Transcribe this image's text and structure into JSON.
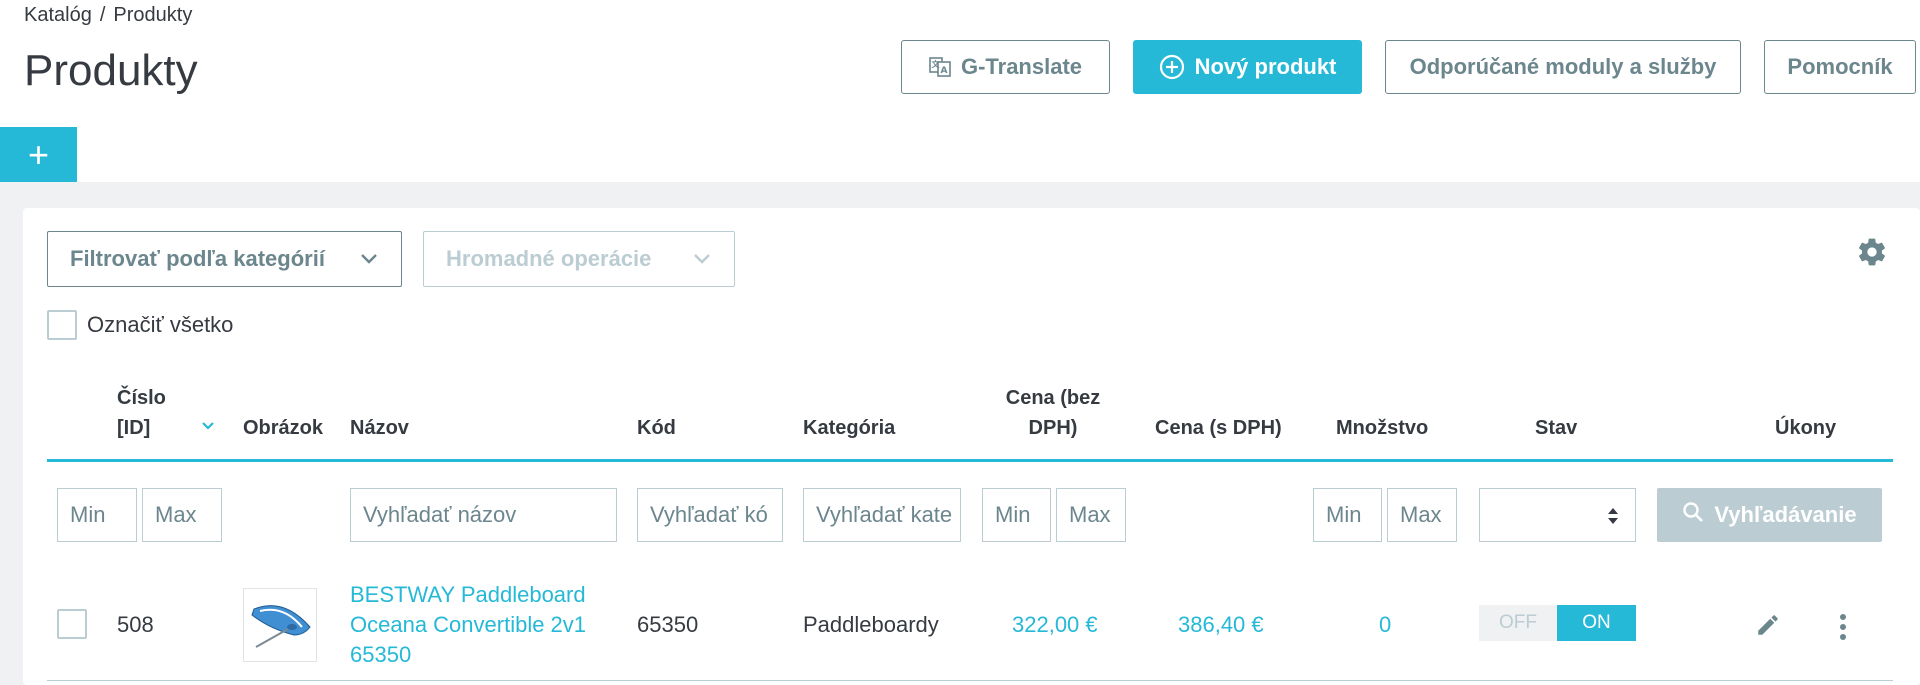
{
  "breadcrumb": {
    "item1": "Katalóg",
    "separator": "/",
    "item2": "Produkty"
  },
  "page_title": "Produkty",
  "header_buttons": {
    "translate": "G-Translate",
    "new_product": "Nový produkt",
    "modules": "Odporúčané moduly a služby",
    "help": "Pomocník"
  },
  "add_tab": "+",
  "filters": {
    "category_dropdown": "Filtrovať podľa kategórií",
    "bulk_actions": "Hromadné operácie",
    "select_all": "Označiť všetko"
  },
  "columns": {
    "id_line1": "Číslo",
    "id_line2": "[ID]",
    "image": "Obrázok",
    "name": "Názov",
    "code": "Kód",
    "category": "Kategória",
    "price_ex_line1": "Cena (bez",
    "price_ex_line2": "DPH)",
    "price_inc": "Cena (s DPH)",
    "quantity": "Množstvo",
    "status": "Stav",
    "actions": "Úkony"
  },
  "filter_inputs": {
    "id_min": "Min",
    "id_max": "Max",
    "name": "Vyhľadať názov",
    "code": "Vyhľadať kó",
    "category": "Vyhľadať kate",
    "price_min": "Min",
    "price_max": "Max",
    "qty_min": "Min",
    "qty_max": "Max",
    "search_button": "Vyhľadávanie"
  },
  "products": [
    {
      "id": "508",
      "name_line1": "BESTWAY Paddleboard",
      "name_line2": "Oceana Convertible 2v1",
      "name_line3": "65350",
      "code": "65350",
      "category": "Paddleboardy",
      "price_ex": "322,00 €",
      "price_inc": "386,40 €",
      "quantity": "0",
      "status_off": "OFF",
      "status_on": "ON"
    }
  ],
  "colors": {
    "accent": "#25b9d7",
    "muted": "#6c868e",
    "border": "#bbcdd2",
    "background": "#eff1f2"
  }
}
